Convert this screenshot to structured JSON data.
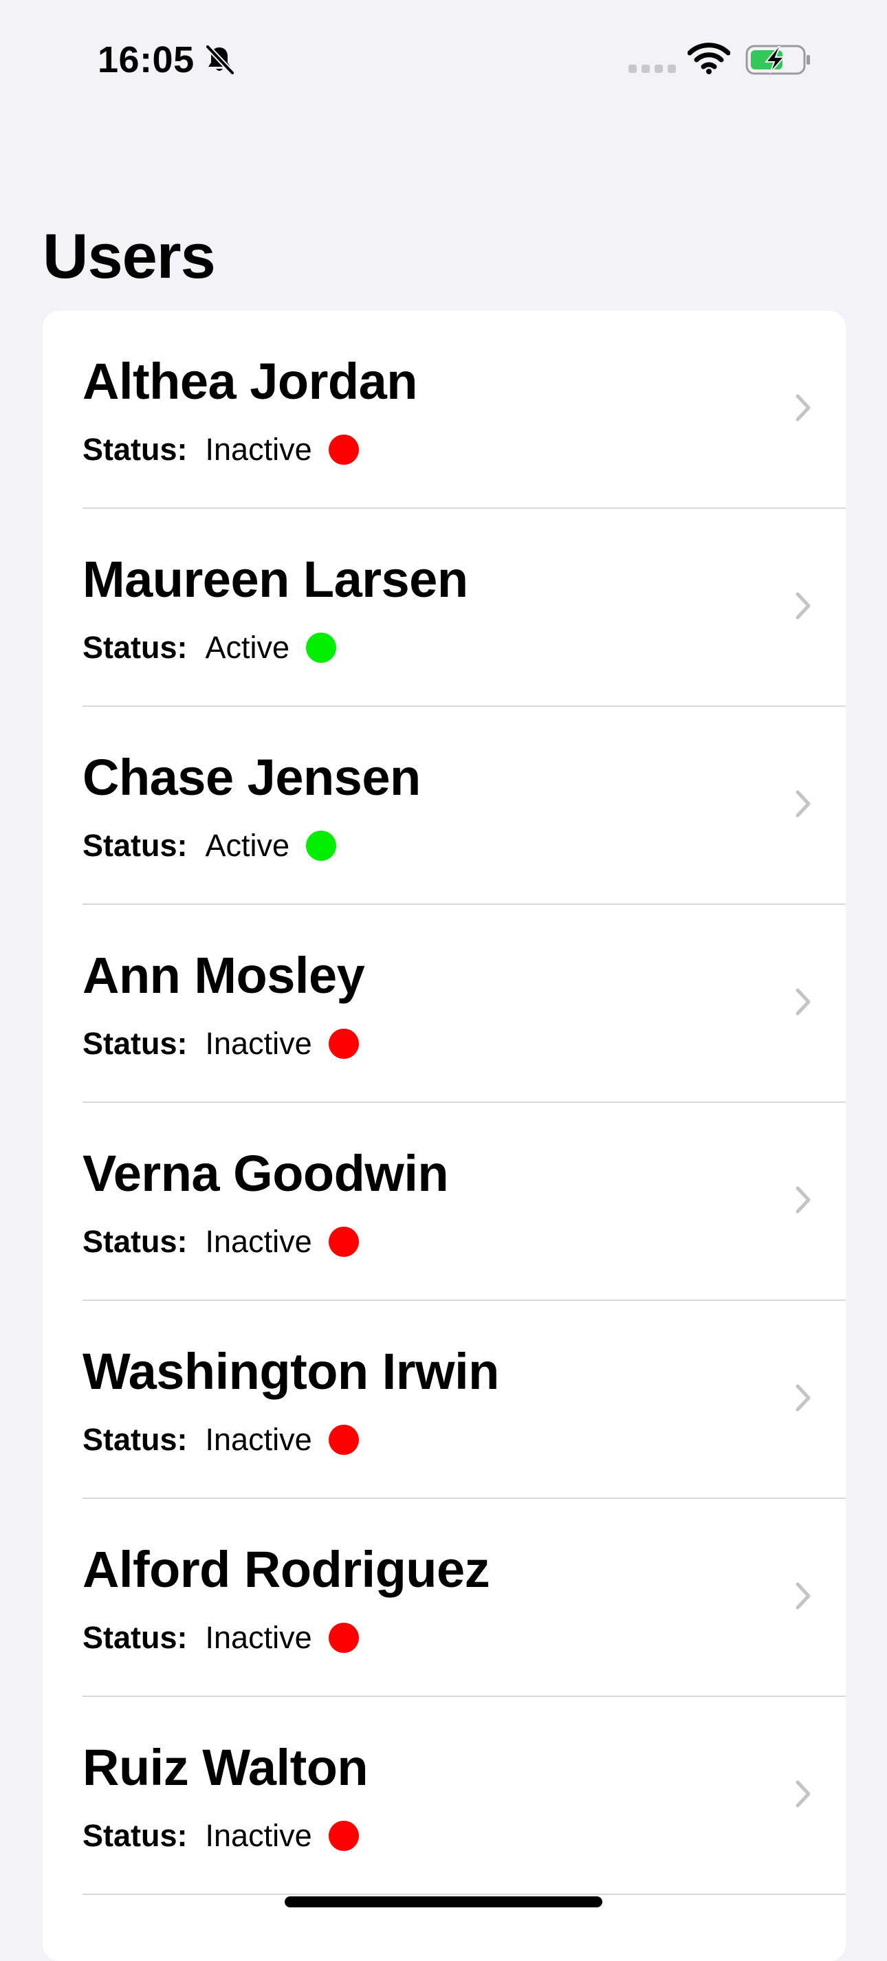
{
  "status_bar": {
    "time": "16:05",
    "icons": [
      "bell-slash-icon",
      "cellular-signal-icon",
      "wifi-icon",
      "battery-charging-icon"
    ]
  },
  "title": "Users",
  "status_label": "Status:",
  "colors": {
    "active": "#00ee00",
    "inactive": "#ff0000",
    "background": "#f2f2f7",
    "chevron": "#c4c4c7"
  },
  "users": [
    {
      "name": "Althea Jordan",
      "status": "Inactive"
    },
    {
      "name": "Maureen Larsen",
      "status": "Active"
    },
    {
      "name": "Chase Jensen",
      "status": "Active"
    },
    {
      "name": "Ann Mosley",
      "status": "Inactive"
    },
    {
      "name": "Verna Goodwin",
      "status": "Inactive"
    },
    {
      "name": "Washington Irwin",
      "status": "Inactive"
    },
    {
      "name": "Alford Rodriguez",
      "status": "Inactive"
    },
    {
      "name": "Ruiz Walton",
      "status": "Inactive"
    }
  ]
}
